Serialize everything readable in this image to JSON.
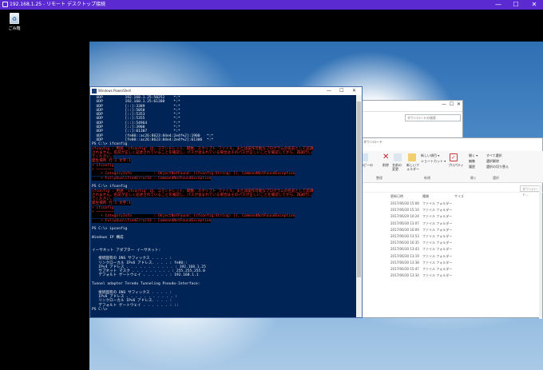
{
  "rdp": {
    "title": "192.168.1.25 - リモート デスクトップ接続",
    "controls": [
      "—",
      "☐",
      "✕"
    ]
  },
  "desktop": {
    "recycle_bin_label": "ごみ箱"
  },
  "explorer_back": {
    "address_placeholder": "ダウンロードの検索"
  },
  "explorer": {
    "title": "ダウンロード",
    "ribbon": {
      "copy_label": "コピーの",
      "delete_label": "削除",
      "rename_label": "名前の変更",
      "new_folder_label": "新しいフォルダー",
      "new_item_label": "新しい項目 ▾",
      "shortcut_label": "ショートカット ▾",
      "properties_label": "プロパティ",
      "open_label": "開く ▾",
      "edit_label": "編集",
      "history_label": "履歴",
      "select_all_label": "すべて選択",
      "select_none_label": "選択解除",
      "invert_label": "選択の切り替え",
      "group_organize": "整理",
      "group_new": "新規",
      "group_open": "開く",
      "group_select": "選択"
    },
    "search_placeholder": "ダウンロード...",
    "columns": [
      "更新日時",
      "種類",
      "サイズ"
    ],
    "rows": [
      {
        "date": "2017/06/30 15:08",
        "type": "ファイル フォルダー"
      },
      {
        "date": "2017/06/30 15:10",
        "type": "ファイル フォルダー"
      },
      {
        "date": "2017/06/29 10:24",
        "type": "ファイル フォルダー"
      },
      {
        "date": "2017/06/30 13:07",
        "type": "ファイル フォルダー"
      },
      {
        "date": "2017/06/30 16:09",
        "type": "ファイル フォルダー"
      },
      {
        "date": "2017/06/30 13:53",
        "type": "ファイル フォルダー"
      },
      {
        "date": "2017/06/30 16:35",
        "type": "ファイル フォルダー"
      },
      {
        "date": "2017/06/30 13:43",
        "type": "ファイル フォルダー"
      },
      {
        "date": "2017/06/30 13:19",
        "type": "ファイル フォルダー"
      },
      {
        "date": "2017/06/30 13:38",
        "type": "ファイル フォルダー"
      },
      {
        "date": "2017/06/30 15:47",
        "type": "ファイル フォルダー"
      },
      {
        "date": "2017/06/30 13:34",
        "type": "ファイル フォルダー"
      }
    ]
  },
  "powershell": {
    "title": "Windows PowerShell",
    "lines": [
      {
        "t": "  UDP          192.168.1.25:50252    *:*",
        "e": false
      },
      {
        "t": "  UDP          192.168.1.25:61308    *:*",
        "e": false
      },
      {
        "t": "  UDP          [::]:3389             *:*",
        "e": false
      },
      {
        "t": "  UDP          [::]:5050             *:*",
        "e": false
      },
      {
        "t": "  UDP          [::]:5353             *:*",
        "e": false
      },
      {
        "t": "  UDP          [::]:5355             *:*",
        "e": false
      },
      {
        "t": "  UDP          [::]:54964            *:*",
        "e": false
      },
      {
        "t": "  UDP          [::]:3900             *:*",
        "e": false
      },
      {
        "t": "  UDP          [::]:61307            *:*",
        "e": false
      },
      {
        "t": "  UDP          [fe80::ac26:8623:84e4:2e4f%2]:1900   *:*",
        "e": false
      },
      {
        "t": "  UDP          [fe80::ac26:8623:84e4:2e4f%2]:61306  *:*",
        "e": false
      },
      {
        "t": "PS C:\\> ifconfig",
        "e": false
      },
      {
        "t": "ifconfig : 用語 'ifconfig' は、コマンドレット、関数、スクリプト ファイル、または操作可能なプログラムの名前として認識",
        "e": true
      },
      {
        "t": "されません。名前が正しく記述されていることを確認し、パスが含まれている場合はそのパスが正しいことを確認してから、再試行し",
        "e": true
      },
      {
        "t": "てください。",
        "e": true
      },
      {
        "t": "発生場所 行:1 文字:1",
        "e": true
      },
      {
        "t": "+ ifconfig",
        "e": true
      },
      {
        "t": "+ ~~~~~~~~",
        "e": true
      },
      {
        "t": "    + CategoryInfo          : ObjectNotFound: (ifconfig:String) [], CommandNotFoundException",
        "e": true
      },
      {
        "t": "    + FullyQualifiedErrorId : CommandNotFoundException",
        "e": true
      },
      {
        "t": "",
        "e": false
      },
      {
        "t": "PS C:\\> ifconfig",
        "e": false
      },
      {
        "t": "ifconfig : 用語 'ifconfig' は、コマンドレット、関数、スクリプト ファイル、または操作可能なプログラムの名前として認識",
        "e": true
      },
      {
        "t": "されません。名前が正しく記述されていることを確認し、パスが含まれている場合はそのパスが正しいことを確認してから、再試行し",
        "e": true
      },
      {
        "t": "てください。",
        "e": true
      },
      {
        "t": "発生場所 行:1 文字:1",
        "e": true
      },
      {
        "t": "+ ifconfig",
        "e": true
      },
      {
        "t": "+ ~~~~~~~~",
        "e": true
      },
      {
        "t": "    + CategoryInfo          : ObjectNotFound: (ifconfig:String) [], CommandNotFoundException",
        "e": true
      },
      {
        "t": "    + FullyQualifiedErrorId : CommandNotFoundException",
        "e": true
      },
      {
        "t": "",
        "e": false
      },
      {
        "t": "PS C:\\> ipconfig",
        "e": false
      },
      {
        "t": "",
        "e": false
      },
      {
        "t": "Windows IP 構成",
        "e": false
      },
      {
        "t": "",
        "e": false
      },
      {
        "t": "",
        "e": false
      },
      {
        "t": "イーサネット アダプター イーサネット:",
        "e": false
      },
      {
        "t": "",
        "e": false
      },
      {
        "t": "   接続固有の DNS サフィックス . . . . :",
        "e": false
      },
      {
        "t": "   リンクローカル IPv6 アドレス. . . . : fe80::",
        "e": false
      },
      {
        "t": "   IPv4 アドレス . . . . . . . . . . . : 192.168.1.25",
        "e": false
      },
      {
        "t": "   サブネット マスク . . . . . . . . . : 255.255.255.0",
        "e": false
      },
      {
        "t": "   デフォルト ゲートウェイ . . . . . . : 192.168.1.1",
        "e": false
      },
      {
        "t": "",
        "e": false
      },
      {
        "t": "Tunnel adapter Teredo Tunneling Pseudo-Interface:",
        "e": false
      },
      {
        "t": "",
        "e": false
      },
      {
        "t": "   接続固有の DNS サフィックス . . . . :",
        "e": false
      },
      {
        "t": "   IPv6 アドレス . . . . . . . . . . . :",
        "e": false
      },
      {
        "t": "   リンクローカル IPv6 アドレス. . . . :",
        "e": false
      },
      {
        "t": "   デフォルト ゲートウェイ . . . . . . : ::",
        "e": false
      },
      {
        "t": "PS C:\\>",
        "e": false
      }
    ]
  }
}
